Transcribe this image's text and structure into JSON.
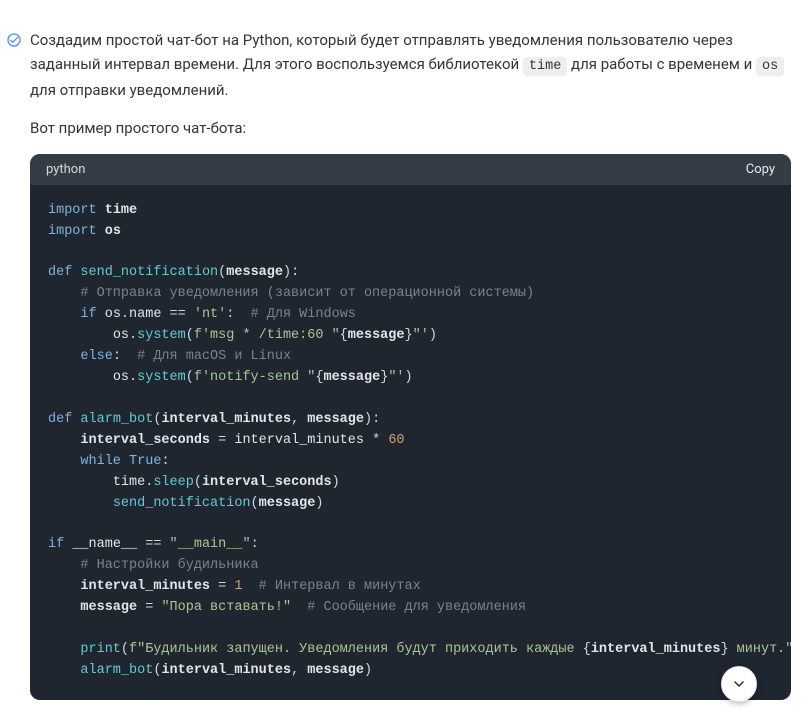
{
  "message": {
    "paragraph1_pre": "Создадим простой чат-бот на Python, который будет отправлять уведомления пользователю через заданный интервал времени. Для этого воспользуемся библиотекой ",
    "inline1": "time",
    "paragraph1_mid": " для работы с временем и ",
    "inline2": "os",
    "paragraph1_post": " для отправки уведомлений.",
    "paragraph2": "Вот пример простого чат-бота:"
  },
  "code": {
    "language": "python",
    "copy_label": "Copy",
    "tokens": {
      "kw_import1": "import",
      "mod_time": "time",
      "kw_import2": "import",
      "mod_os": "os",
      "kw_def1": "def",
      "fn_send": "send_notification",
      "par_message1": "message",
      "com_send": "# Отправка уведомления (зависит от операционной системы)",
      "kw_if1": "if",
      "id_os1": "os",
      "id_name": "name",
      "op_eq1": "==",
      "str_nt": "'nt'",
      "com_win": "# Для Windows",
      "id_os2": "os",
      "call_system1": "system",
      "fs1_a": "f'msg * /time:60 \"",
      "fint1": "message",
      "fs1_b": "\"'",
      "kw_else": "else",
      "com_mac": "# Для macOS и Linux",
      "id_os3": "os",
      "call_system2": "system",
      "fs2_a": "f'notify-send \"",
      "fint2": "message",
      "fs2_b": "\"'",
      "kw_def2": "def",
      "fn_alarm": "alarm_bot",
      "par_int": "interval_minutes",
      "par_msg2": "message",
      "id_intsec": "interval_seconds",
      "op_assign1": "=",
      "id_intmin1": "interval_minutes",
      "op_mul": "*",
      "num_60": "60",
      "kw_while": "while",
      "kw_true": "True",
      "id_time": "time",
      "call_sleep": "sleep",
      "id_intsec2": "interval_seconds",
      "call_sendn": "send_notification",
      "id_msg3": "message",
      "kw_if2": "if",
      "dun_name": "__name__",
      "op_eq2": "==",
      "str_main": "\"__main__\"",
      "com_set": "# Настройки будильника",
      "id_intmin2": "interval_minutes",
      "op_assign2": "=",
      "num_1": "1",
      "com_int": "# Интервал в минутах",
      "id_msg4": "message",
      "op_assign3": "=",
      "str_wake": "\"Пора вставать!\"",
      "com_msg": "# Сообщение для уведомления",
      "call_print": "print",
      "fs3_a": "f\"Будильник запущен. Уведомления будут приходить каждые ",
      "fint3": "interval_minutes",
      "fs3_b": " минут.\"",
      "call_alarm": "alarm_bot",
      "id_intmin3": "interval_minutes",
      "id_msg5": "message"
    }
  }
}
